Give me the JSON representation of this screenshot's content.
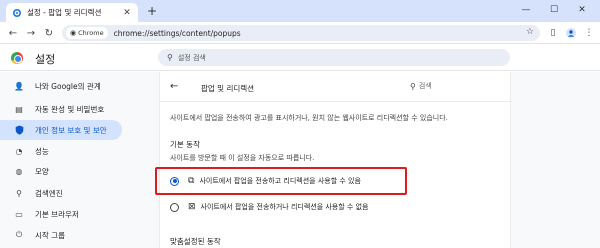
{
  "browser": {
    "tab_title": "설정 - 팝업 및 리디렉션",
    "new_tab": "+",
    "window_controls": {
      "minimize": "—",
      "maximize": "☐",
      "close": "✕"
    },
    "chip_label": "Chrome",
    "url": "chrome://settings/content/popups"
  },
  "settings": {
    "title": "설정",
    "search_placeholder": "설정 검색"
  },
  "sidebar": {
    "items": [
      {
        "label": "나와 Google의 관계",
        "icon": "person-icon",
        "active": false
      },
      {
        "label": "자동 완성 및 비밀번호",
        "icon": "clipboard-icon",
        "active": false
      },
      {
        "label": "개인 정보 보호 및 보안",
        "icon": "shield-icon",
        "active": true
      },
      {
        "label": "성능",
        "icon": "speedometer-icon",
        "active": false
      },
      {
        "label": "모양",
        "icon": "palette-icon",
        "active": false
      },
      {
        "label": "검색엔진",
        "icon": "search-icon",
        "active": false
      },
      {
        "label": "기본 브라우저",
        "icon": "browser-icon",
        "active": false
      },
      {
        "label": "시작 그룹",
        "icon": "power-icon",
        "active": false
      }
    ]
  },
  "page": {
    "title": "팝업 및 리디렉션",
    "search_placeholder": "검색",
    "description": "사이트에서 팝업을 전송하여 광고를 표시하거나, 원치 않는 웹사이트로 리디렉션할 수 있습니다.",
    "default_behavior_title": "기본 동작",
    "default_behavior_sub": "사이트를 방문할 때 이 설정을 자동으로 따릅니다.",
    "options": [
      {
        "label": "사이트에서 팝업을 전송하고 리디렉션을 사용할 수 있음",
        "icon": "popup-open-icon",
        "checked": true
      },
      {
        "label": "사이트에서 팝업을 전송하거나 리디렉션을 사용할 수 없음",
        "icon": "popup-blocked-icon",
        "checked": false
      }
    ],
    "custom_title": "맞춤설정된 동작"
  },
  "colors": {
    "accent": "#0b57d0",
    "active_nav_bg": "#d3e3fd",
    "highlight_border": "#e0191a"
  }
}
